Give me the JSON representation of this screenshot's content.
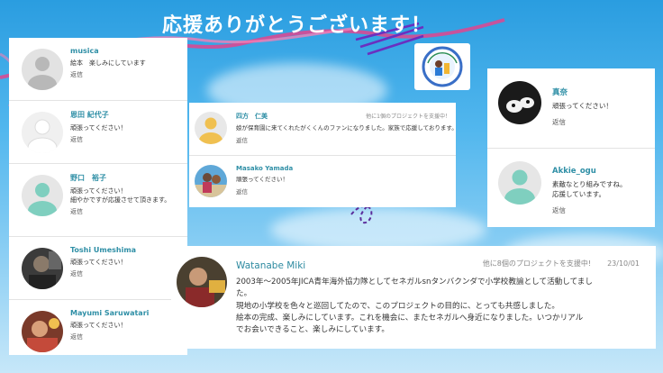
{
  "title": "応援ありがとうございます！",
  "colors": {
    "accent_name": "#2f8fa6",
    "scribble": "#e0458f",
    "plane": "#5b2d9c"
  },
  "badge": {
    "icon": "association-logo-icon"
  },
  "left_comments": [
    {
      "name": "musica",
      "text": "絵本　楽しみにしています",
      "reply": "返信",
      "avatar": "default-avatar-icon"
    },
    {
      "name": "恩田 紀代子",
      "text": "頑張ってください！",
      "reply": "返信",
      "avatar": "default-avatar-icon"
    },
    {
      "name": "野口　裕子",
      "text": "頑張ってください！\n細やかですが応援させて頂きます。",
      "reply": "返信",
      "avatar": "teal-avatar-icon"
    },
    {
      "name": "Toshi Umeshima",
      "text": "頑張ってください！",
      "reply": "返信",
      "avatar": "photo-avatar"
    },
    {
      "name": "Mayumi Saruwatari",
      "text": "頑張ってください！",
      "reply": "返信",
      "avatar": "photo-avatar"
    }
  ],
  "mid_comments": [
    {
      "name": "四方　仁美",
      "meta": "他に1個のプロジェクトを支援中！",
      "text": "娘が保育園に来てくれたがくくんのファンになりました。家族で応援しております。",
      "reply": "返信",
      "avatar": "yellow-avatar-icon"
    },
    {
      "name": "Masako Yamada",
      "text": "頑張ってください！",
      "reply": "返信",
      "avatar": "photo-avatar"
    }
  ],
  "right_comments": [
    {
      "name": "真奈",
      "text": "頑張ってください！",
      "reply": "返信",
      "avatar": "photo-avatar"
    },
    {
      "name": "Akkie_ogu",
      "text": "素敵なとり組みですね。\n応援しています。",
      "reply": "返信",
      "avatar": "teal-avatar-icon"
    }
  ],
  "bottom_comment": {
    "name": "Watanabe Miki",
    "meta": "他に8個のプロジェクトを支援中!",
    "date": "23/10/01",
    "lines": [
      "2003年～2005年JICA青年海外協力隊としてセネガルsnタンバクンダで小学校教諭として活動してまし",
      "た。",
      "現地の小学校を色々と巡回してたので、このプロジェクトの目的に、とっても共感しました。",
      "絵本の完成、楽しみにしています。これを機会に、またセネガルへ身近になりました。いつかリアル",
      "でお会いできること、楽しみにしています。"
    ],
    "avatar": "photo-avatar"
  }
}
